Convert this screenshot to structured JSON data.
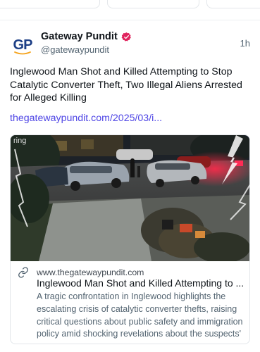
{
  "post": {
    "author_name": "Gateway Pundit",
    "author_handle": "@gatewaypundit",
    "avatar_text": "GP",
    "timestamp": "1h",
    "text": "Inglewood Man Shot and Killed Attempting to Stop Catalytic Converter Theft, Two Illegal Aliens Arrested for Alleged Killing",
    "link_text": "thegatewaypundit.com/2025/03/i..."
  },
  "link_card": {
    "domain": "www.thegatewaypundit.com",
    "title": "Inglewood Man Shot and Killed Attempting to ...",
    "description": "A tragic confrontation in Inglewood highlights the escalating crisis of catalytic converter thefts, raising critical questions about public safety and immigration policy amid shocking revelations about the suspects' ...",
    "image_caption_text": "ring"
  },
  "colors": {
    "accent": "#4f46e5",
    "tab_underline": "#6b5cf5",
    "verified_badge": "#e0245e",
    "brand_navy": "#1d3f86",
    "brand_orange": "#f5a623"
  }
}
